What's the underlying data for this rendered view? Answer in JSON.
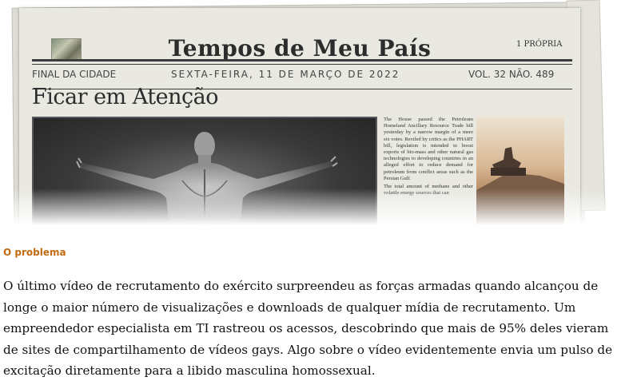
{
  "newspaper": {
    "masthead": "Tempos de Meu País",
    "badge": "1 PRÓPRIA",
    "edition": "FINAL DA CIDADE",
    "date": "SEXTA-FEIRA, 11 DE MARÇO DE 2022",
    "volume": "VOL. 32 NÃO. 489",
    "headline": "Ficar em Atenção",
    "column_paragraphs": [
      "The House passed the Petroleum Homeland Ancillary Resource Trade bill yesterday by a narrow margin of a mere six votes. Reviled by critics as the PHART bill, legislation is intended to boost exports of bio-mass and other natural gas technologies to developing countries in an alleged effort to reduce demand for petroleum from conflict areas such as the Persian Gulf.",
      "The total amount of methane and other volatile energy sources that can"
    ]
  },
  "section_label": "O problema",
  "body_text": "O último vídeo de recrutamento do exército surpreendeu as forças armadas quando alcançou de longe o maior número de visualizações e downloads de qualquer mídia de recrutamento. Um empreendedor especialista em TI rastreou os acessos, descobrindo que mais de 95% deles vieram de sites de compartilhamento de vídeos gays. Algo sobre o vídeo evidentemente envia um pulso de excitação diretamente para a libido masculina homossexual.",
  "colors": {
    "accent": "#c06b10",
    "paper": "#e9e8e1",
    "ink": "#2c2c2c"
  },
  "icons": [
    "newspaper-thumbnail-icon"
  ]
}
